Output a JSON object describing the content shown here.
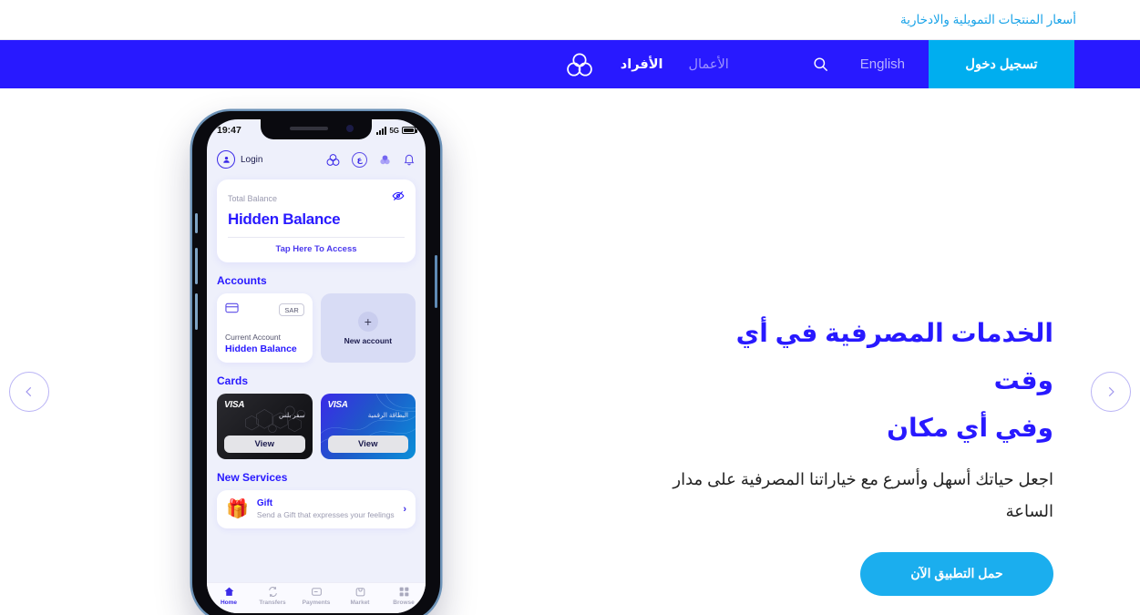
{
  "ticker": {
    "text": "أسعار المنتجات التمويلية والادخارية"
  },
  "nav": {
    "login_label": "تسجيل دخول",
    "language_label": "English",
    "search_icon": "search-icon",
    "brand_icon": "trefoil-logo-icon",
    "tabs": [
      {
        "label": "الأفراد",
        "state": "active"
      },
      {
        "label": "الأعمال",
        "state": "inactive"
      }
    ]
  },
  "carousel": {
    "prev_icon": "chevron-left-icon",
    "next_icon": "chevron-right-icon"
  },
  "hero": {
    "title_line1": "الخدمات المصرفية في أي وقت",
    "title_line2": "وفي أي مكان",
    "subtitle": "اجعل حياتك أسهل وأسرع مع خياراتنا المصرفية على مدار الساعة",
    "cta_label": "حمل التطبيق الآن"
  },
  "phone": {
    "status": {
      "time": "19:47",
      "network": "5G",
      "signal_icon": "signal-bars-icon",
      "battery_icon": "battery-icon"
    },
    "app_header": {
      "login_label": "Login",
      "avatar_icon": "user-avatar-icon",
      "icons": [
        {
          "name": "trefoil-logo-icon",
          "label": ""
        },
        {
          "name": "arabic-language-icon",
          "label": "ع"
        },
        {
          "name": "circles-icon",
          "label": ""
        },
        {
          "name": "bell-icon",
          "label": ""
        }
      ]
    },
    "balance": {
      "label": "Total Balance",
      "value": "Hidden Balance",
      "access_label": "Tap Here To Access",
      "eye_icon": "eye-off-icon"
    },
    "accounts": {
      "section_title": "Accounts",
      "account": {
        "currency": "SAR",
        "name": "Current Account",
        "balance": "Hidden Balance",
        "card_icon": "credit-card-icon"
      },
      "new_account": {
        "label": "New account",
        "plus_icon": "plus-icon",
        "plus_glyph": "+"
      }
    },
    "cards": {
      "section_title": "Cards",
      "items": [
        {
          "brand": "VISA",
          "name": "سفر بلس",
          "button_label": "View",
          "style": "dark"
        },
        {
          "brand": "VISA",
          "name": "البطاقة الرقمية",
          "button_label": "View",
          "style": "blue"
        }
      ]
    },
    "services": {
      "section_title": "New Services",
      "item": {
        "icon": "gift-icon",
        "glyph": "🎁",
        "title": "Gift",
        "description": "Send a Gift that expresses your feelings",
        "chevron": "›"
      }
    },
    "tabbar": [
      {
        "label": "Home",
        "icon": "home-icon",
        "state": "active"
      },
      {
        "label": "Transfers",
        "icon": "transfers-icon",
        "state": "inactive"
      },
      {
        "label": "Payments",
        "icon": "payments-icon",
        "state": "inactive"
      },
      {
        "label": "Market",
        "icon": "market-icon",
        "state": "inactive"
      },
      {
        "label": "Browse",
        "icon": "browse-grid-icon",
        "state": "inactive"
      }
    ]
  },
  "colors": {
    "nav_blue": "#2819FF",
    "cyan": "#00AEEF",
    "ticker_cyan": "#19A3E8",
    "cta_blue": "#1BAEEE",
    "app_bg": "#EEF0FB"
  }
}
